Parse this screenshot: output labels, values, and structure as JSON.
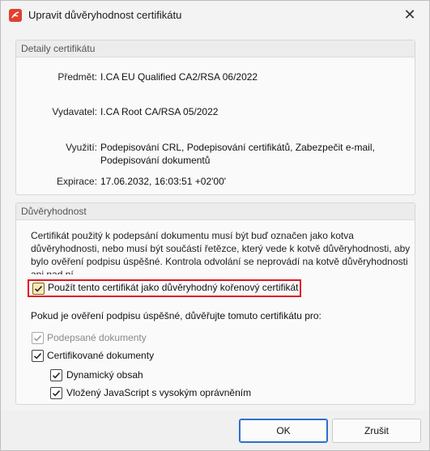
{
  "window": {
    "title": "Upravit důvěryhodnost certifikátu"
  },
  "details": {
    "header": "Detaily certifikátu",
    "subject_label": "Předmět:",
    "subject_value": "I.CA EU Qualified CA2/RSA 06/2022",
    "issuer_label": "Vydavatel:",
    "issuer_value": "I.CA Root CA/RSA 05/2022",
    "usage_label": "Využití:",
    "usage_line1": "Podepisování CRL, Podepisování certifikátů, Zabezpečit e-mail,",
    "usage_line2": "Podepisování dokumentů",
    "expiry_label": "Expirace:",
    "expiry_value": "17.06.2032, 16:03:51 +02'00'"
  },
  "trust": {
    "header": "Důvěryhodnost",
    "paragraph_lines": [
      "Certifikát použitý k podepsání dokumentu musí být buď označen jako kotva",
      "důvěryhodnosti, nebo musí být součástí řetězce, který vede k kotvě důvěryhodnosti, aby",
      "bylo ověření podpisu úspěšné. Kontrola odvolání se neprovádí na kotvě důvěryhodnosti",
      "ani nad ní."
    ],
    "root_checkbox_label": "Použít tento certifikát jako důvěryhodný kořenový certifikát",
    "root_checked": true,
    "if_success_text": "Pokud je ověření podpisu úspěšné, důvěřujte tomuto certifikátu pro:",
    "signed_docs_label": "Podepsané dokumenty",
    "signed_docs_checked": true,
    "signed_docs_disabled": true,
    "certified_docs_label": "Certifikované dokumenty",
    "certified_docs_checked": true,
    "dynamic_label": "Dynamický obsah",
    "dynamic_checked": true,
    "js_label": "Vložený JavaScript s vysokým oprávněním",
    "js_checked": true
  },
  "buttons": {
    "ok": "OK",
    "cancel": "Zrušit"
  },
  "colors": {
    "accent": "#2f6fcf",
    "highlight_box": "#e0181b",
    "app_icon": "#e0402f"
  },
  "icons": {
    "app": "pdf-app-icon",
    "close": "close-icon",
    "check": "checkmark-icon"
  }
}
